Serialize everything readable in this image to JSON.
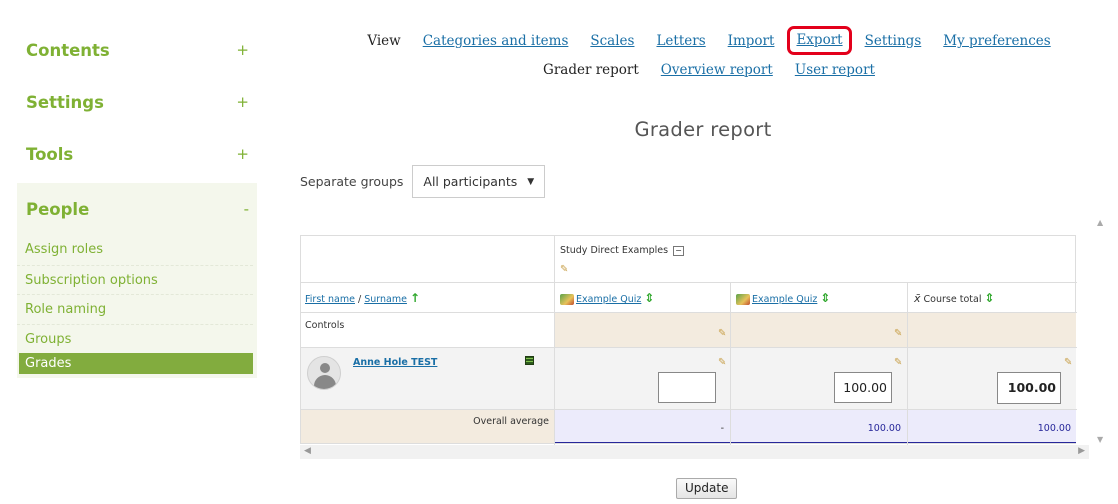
{
  "sidebar": {
    "blocks": [
      {
        "title": "Contents",
        "toggle": "+"
      },
      {
        "title": "Settings",
        "toggle": "+"
      },
      {
        "title": "Tools",
        "toggle": "+"
      }
    ],
    "people": {
      "title": "People",
      "toggle": "-",
      "items": [
        "Assign roles",
        "Subscription options",
        "Role naming",
        "Groups",
        "Grades"
      ],
      "active": "Grades"
    }
  },
  "nav": {
    "row1": {
      "view": "View",
      "categories": "Categories and items",
      "scales": "Scales",
      "letters": "Letters",
      "import": "Import",
      "export": "Export",
      "settings": "Settings",
      "preferences": "My preferences"
    },
    "row2": {
      "grader": "Grader report",
      "overview": "Overview report",
      "user": "User report"
    }
  },
  "page_title": "Grader report",
  "groups": {
    "label": "Separate groups",
    "selected": "All participants"
  },
  "table": {
    "category": "Study Direct Examples",
    "category_toggle": "−",
    "first_name": "First name",
    "separator": " / ",
    "surname": "Surname",
    "controls": "Controls",
    "columns": [
      "Example Quiz",
      "Example Quiz",
      "Course total"
    ],
    "course_total_symbol": "x̄",
    "student": "Anne Hole TEST",
    "grades": [
      "",
      "100.00",
      "100.00"
    ],
    "overall_label": "Overall average",
    "averages": [
      "-",
      "100.00",
      "100.00"
    ]
  },
  "update_label": "Update"
}
